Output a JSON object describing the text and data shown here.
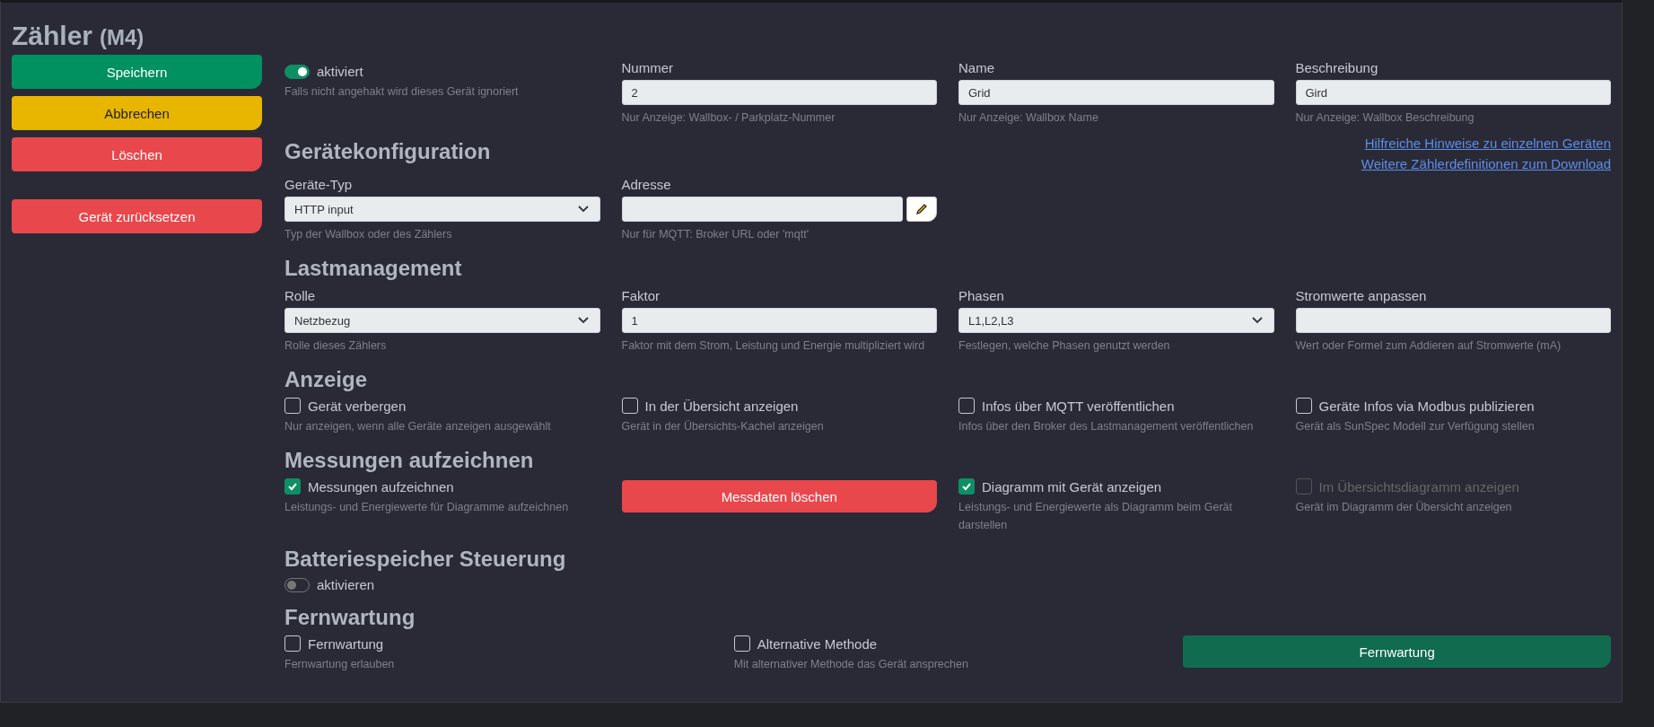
{
  "title": "Zähler",
  "title_badge": "(M4)",
  "actions": [
    {
      "label": "Speichern",
      "kind": "save"
    },
    {
      "label": "Abbrechen",
      "kind": "cancel"
    },
    {
      "label": "Löschen",
      "kind": "delete"
    },
    {
      "label": "Gerät zurücksetzen",
      "kind": "reset"
    }
  ],
  "sections": [
    {
      "kind": "quarters",
      "items": [
        {
          "kind": "toggle",
          "label": "aktiviert",
          "on": true,
          "hint": "Falls nicht angehakt wird dieses Gerät ignoriert"
        },
        {
          "kind": "input",
          "label": "Nummer",
          "value": "2",
          "hint": "Nur Anzeige: Wallbox- / Parkplatz-Nummer"
        },
        {
          "kind": "input",
          "label": "Name",
          "value": "Grid",
          "hint": "Nur Anzeige: Wallbox Name"
        },
        {
          "kind": "input",
          "label": "Beschreibung",
          "value": "Gird",
          "hint": "Nur Anzeige: Wallbox Beschreibung"
        }
      ]
    },
    {
      "heading": "Gerätekonfiguration",
      "kind": "quarters",
      "links": [
        "Hilfreiche Hinweise zu einzelnen Geräten",
        "Weitere Zählerdefinitionen zum Download"
      ],
      "items": [
        {
          "kind": "select",
          "label": "Geräte-Typ",
          "value": "HTTP input",
          "hint": "Typ der Wallbox oder des Zählers"
        },
        {
          "kind": "input_edit",
          "label": "Adresse",
          "hint": "Nur für MQTT: Broker URL oder 'mqtt'"
        }
      ]
    },
    {
      "heading": "Lastmanagement",
      "kind": "quarters",
      "items": [
        {
          "kind": "select",
          "label": "Rolle",
          "value": "Netzbezug",
          "hint": "Rolle dieses Zählers"
        },
        {
          "kind": "input",
          "label": "Faktor",
          "value": "1",
          "hint": "Faktor mit dem Strom, Leistung und Energie multipliziert wird"
        },
        {
          "kind": "select",
          "label": "Phasen",
          "value": "L1,L2,L3",
          "hint": "Festlegen, welche Phasen genutzt werden"
        },
        {
          "kind": "input",
          "label": "Stromwerte anpassen",
          "hint": "Wert oder Formel zum Addieren auf Stromwerte (mA)"
        }
      ]
    },
    {
      "heading": "Anzeige",
      "kind": "quarters",
      "items": [
        {
          "kind": "checkbox",
          "label": "Gerät verbergen",
          "checked": false,
          "disabled": false,
          "hint": "Nur anzeigen, wenn alle Geräte anzeigen ausgewählt"
        },
        {
          "kind": "checkbox",
          "label": "In der Übersicht anzeigen",
          "checked": false,
          "disabled": false,
          "hint": "Gerät in der Übersichts-Kachel anzeigen"
        },
        {
          "kind": "checkbox",
          "label": "Infos über MQTT veröffentlichen",
          "checked": false,
          "disabled": false,
          "hint": "Infos über den Broker des Lastmanagement veröffentlichen"
        },
        {
          "kind": "checkbox",
          "label": "Geräte Infos via Modbus publizieren",
          "checked": false,
          "disabled": false,
          "hint": "Gerät als SunSpec Modell zur Verfügung stellen"
        }
      ]
    },
    {
      "heading": "Messungen aufzeichnen",
      "kind": "quarters",
      "items": [
        {
          "kind": "checkbox",
          "label": "Messungen aufzeichnen",
          "checked": true,
          "disabled": false,
          "hint": "Leistungs- und Energiewerte für Diagramme aufzeichnen"
        },
        {
          "kind": "danger_button",
          "label": "Messdaten löschen"
        },
        {
          "kind": "checkbox",
          "label": "Diagramm mit Gerät anzeigen",
          "checked": true,
          "disabled": false,
          "hint": "Leistungs- und Energiewerte als Diagramm beim Gerät darstellen"
        },
        {
          "kind": "checkbox",
          "label": "Im Übersichtsdiagramm anzeigen",
          "checked": false,
          "disabled": true,
          "hint": "Gerät im Diagramm der Übersicht anzeigen"
        }
      ]
    },
    {
      "heading": "Batteriespeicher Steuerung",
      "kind": "quarters",
      "items": [
        {
          "kind": "toggle",
          "label": "aktivieren",
          "on": false
        }
      ]
    },
    {
      "heading": "Fernwartung",
      "kind": "thirds",
      "items": [
        {
          "kind": "checkbox",
          "label": "Fernwartung",
          "checked": false,
          "disabled": false,
          "hint": "Fernwartung erlauben"
        },
        {
          "kind": "checkbox",
          "label": "Alternative Methode",
          "checked": false,
          "disabled": false,
          "hint": "Mit alternativer Methode das Gerät ansprechen"
        },
        {
          "kind": "remote_button",
          "label": "Fernwartung"
        }
      ]
    }
  ]
}
